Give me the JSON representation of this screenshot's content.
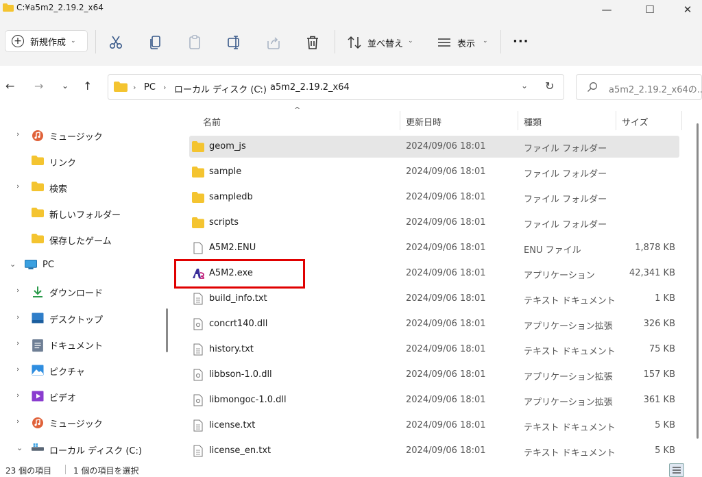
{
  "window": {
    "title": "C:¥a5m2_2.19.2_x64"
  },
  "window_controls": {
    "minimize": "—",
    "maximize": "☐",
    "close": "✕"
  },
  "toolbar": {
    "new_label": "新規作成",
    "sort_label": "並べ替え",
    "view_label": "表示",
    "more_label": "···"
  },
  "address": {
    "crumbs": [
      "PC",
      "ローカル ディスク (C:)",
      "a5m2_2.19.2_x64"
    ],
    "search_placeholder": "a5m2_2.19.2_x64の..."
  },
  "sidebar": {
    "items": [
      {
        "label": "ミュージック",
        "icon": "music-icon",
        "chevron": "›"
      },
      {
        "label": "リンク",
        "icon": "folder-icon",
        "chevron": ""
      },
      {
        "label": "検索",
        "icon": "folder-icon",
        "chevron": "›"
      },
      {
        "label": "新しいフォルダー",
        "icon": "folder-icon",
        "chevron": ""
      },
      {
        "label": "保存したゲーム",
        "icon": "folder-icon",
        "chevron": ""
      },
      {
        "label": "PC",
        "icon": "pc-icon",
        "chevron": "⌄"
      },
      {
        "label": "ダウンロード",
        "icon": "download-icon",
        "chevron": "›"
      },
      {
        "label": "デスクトップ",
        "icon": "desktop-icon",
        "chevron": "›"
      },
      {
        "label": "ドキュメント",
        "icon": "document-icon",
        "chevron": "›"
      },
      {
        "label": "ピクチャ",
        "icon": "pictures-icon",
        "chevron": "›"
      },
      {
        "label": "ビデオ",
        "icon": "video-icon",
        "chevron": "›"
      },
      {
        "label": "ミュージック",
        "icon": "music-icon",
        "chevron": "›"
      },
      {
        "label": "ローカル ディスク (C:)",
        "icon": "drive-icon",
        "chevron": "⌄"
      }
    ]
  },
  "columns": {
    "name": "名前",
    "date": "更新日時",
    "type": "種類",
    "size": "サイズ"
  },
  "files": [
    {
      "name": "geom_js",
      "date": "2024/09/06 18:01",
      "type": "ファイル フォルダー",
      "size": "",
      "icon": "folder-icon"
    },
    {
      "name": "sample",
      "date": "2024/09/06 18:01",
      "type": "ファイル フォルダー",
      "size": "",
      "icon": "folder-icon"
    },
    {
      "name": "sampledb",
      "date": "2024/09/06 18:01",
      "type": "ファイル フォルダー",
      "size": "",
      "icon": "folder-icon"
    },
    {
      "name": "scripts",
      "date": "2024/09/06 18:01",
      "type": "ファイル フォルダー",
      "size": "",
      "icon": "folder-icon"
    },
    {
      "name": "A5M2.ENU",
      "date": "2024/09/06 18:01",
      "type": "ENU ファイル",
      "size": "1,878 KB",
      "icon": "file-icon"
    },
    {
      "name": "A5M2.exe",
      "date": "2024/09/06 18:01",
      "type": "アプリケーション",
      "size": "42,341 KB",
      "icon": "app-icon"
    },
    {
      "name": "build_info.txt",
      "date": "2024/09/06 18:01",
      "type": "テキスト ドキュメント",
      "size": "1 KB",
      "icon": "text-file-icon"
    },
    {
      "name": "concrt140.dll",
      "date": "2024/09/06 18:01",
      "type": "アプリケーション拡張",
      "size": "326 KB",
      "icon": "dll-icon"
    },
    {
      "name": "history.txt",
      "date": "2024/09/06 18:01",
      "type": "テキスト ドキュメント",
      "size": "75 KB",
      "icon": "text-file-icon"
    },
    {
      "name": "libbson-1.0.dll",
      "date": "2024/09/06 18:01",
      "type": "アプリケーション拡張",
      "size": "157 KB",
      "icon": "dll-icon"
    },
    {
      "name": "libmongoc-1.0.dll",
      "date": "2024/09/06 18:01",
      "type": "アプリケーション拡張",
      "size": "361 KB",
      "icon": "dll-icon"
    },
    {
      "name": "license.txt",
      "date": "2024/09/06 18:01",
      "type": "テキスト ドキュメント",
      "size": "5 KB",
      "icon": "text-file-icon"
    },
    {
      "name": "license_en.txt",
      "date": "2024/09/06 18:01",
      "type": "テキスト ドキュメント",
      "size": "5 KB",
      "icon": "text-file-icon"
    }
  ],
  "status": {
    "item_count": "23 個の項目",
    "selection": "1 個の項目を選択"
  },
  "colors": {
    "folder": "#f4c430",
    "highlight": "#e00000",
    "selected_row": "#e6e6e6"
  }
}
